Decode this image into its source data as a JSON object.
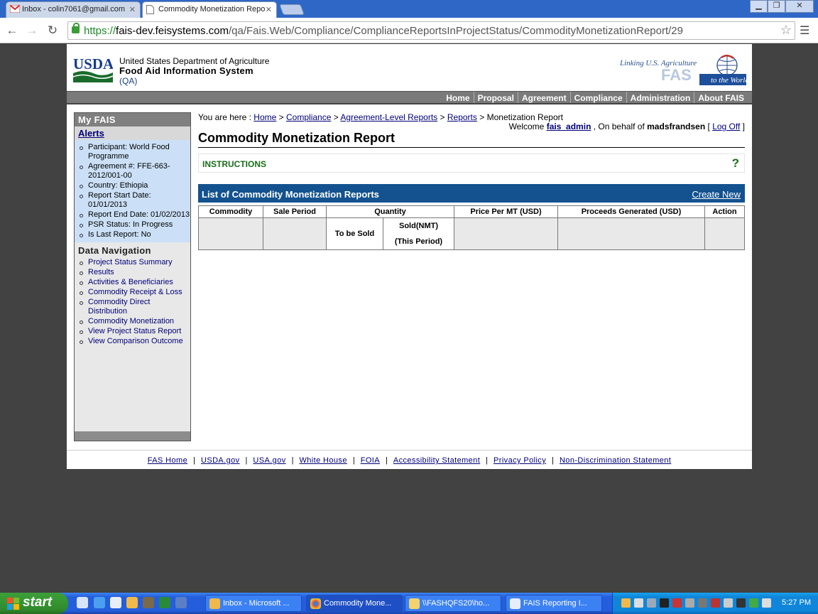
{
  "browser": {
    "tabs": [
      {
        "label": "Inbox - colin7061@gmail.com",
        "active": false
      },
      {
        "label": "Commodity Monetization Repo",
        "active": true
      }
    ],
    "url": {
      "scheme": "https://",
      "host": "fais-dev.feisystems.com",
      "path": "/qa/Fais.Web/Compliance/ComplianceReportsInProjectStatus/CommodityMonetizationReport/29"
    }
  },
  "header": {
    "usda": "USDA",
    "agency": "United States Department of Agriculture",
    "system": "Food Aid Information System",
    "env": "(QA)",
    "fas_tagline": "Linking U.S. Agriculture",
    "fas": "FAS",
    "fas_world": "to the World"
  },
  "nav": [
    "Home",
    "Proposal",
    "Agreement",
    "Compliance",
    "Administration",
    "About FAIS"
  ],
  "sidebar": {
    "title": "My FAIS",
    "alerts_heading": "Alerts",
    "alerts": [
      "Participant: World Food Programme",
      "Agreement #: FFE-663-2012/001-00",
      "Country: Ethiopia",
      "Report Start Date: 01/01/2013",
      "Report End Date: 01/02/2013",
      "PSR Status: In Progress",
      "Is Last Report: No"
    ],
    "data_nav_heading": "Data Navigation",
    "data_nav": [
      "Project Status Summary",
      "Results",
      "Activities & Beneficiaries",
      "Commodity Receipt & Loss",
      "Commodity Direct Distribution",
      "Commodity Monetization",
      "View Project Status Report",
      "View Comparison Outcome"
    ]
  },
  "breadcrumb": {
    "prefix": "You are here :",
    "links": [
      "Home",
      "Compliance",
      "Agreement-Level Reports",
      "Reports"
    ],
    "current": "Monetization Report",
    "sep": ">"
  },
  "welcome": {
    "label": "Welcome",
    "user": "fais_admin",
    "behalf": ", On behalf of",
    "behalf_user": "madsfrandsen",
    "logoff": "Log Off"
  },
  "page_title": "Commodity Monetization Report",
  "instructions": {
    "label": "INSTRUCTIONS",
    "help": "?"
  },
  "report_list": {
    "title": "List of Commodity Monetization Reports",
    "create_new": "Create New",
    "columns": [
      "Commodity",
      "Sale Period",
      "Quantity",
      "Price Per MT (USD)",
      "Proceeds Generated (USD)",
      "Action"
    ],
    "quantity_sub": {
      "to_be_sold": "To be Sold",
      "sold_line1": "Sold(NMT)",
      "sold_line2": "(This Period)"
    }
  },
  "footer": [
    "FAS Home",
    "USDA.gov",
    "USA.gov",
    "White House",
    "FOIA",
    "Accessibility Statement",
    "Privacy Policy",
    "Non-Discrimination Statement"
  ],
  "taskbar": {
    "start": "start",
    "windows": [
      {
        "label": "Inbox - Microsoft ...",
        "active": false
      },
      {
        "label": "Commodity Mone...",
        "active": true
      },
      {
        "label": "\\\\FASHQFS20\\ho...",
        "active": false
      },
      {
        "label": "FAIS Reporting I...",
        "active": false
      }
    ],
    "clock": "5:27 PM"
  }
}
